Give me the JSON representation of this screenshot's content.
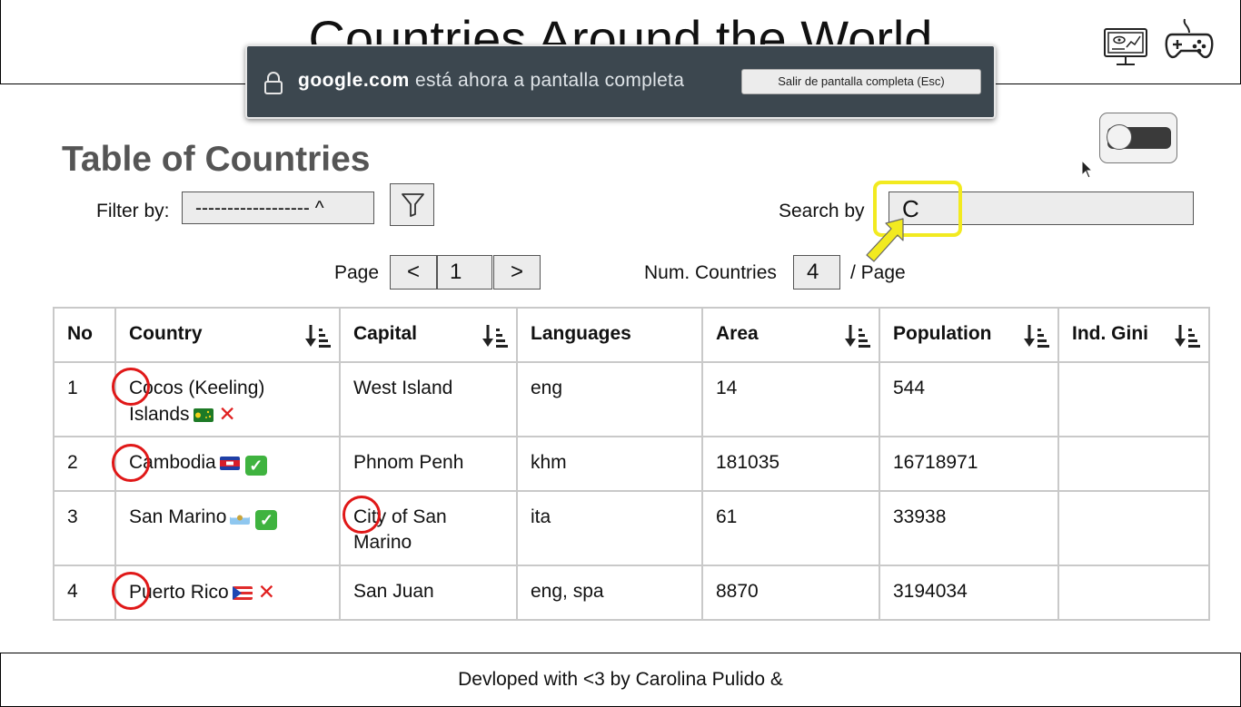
{
  "header": {
    "title": "Countries Around the World",
    "icons": [
      "dashboard-monitor-icon",
      "gamepad-icon"
    ]
  },
  "fullscreen_notice": {
    "domain": "google.com",
    "message": "está ahora a pantalla completa",
    "exit_button": "Salir de pantalla completa (Esc)"
  },
  "toggle": {
    "state": "off"
  },
  "section_title": "Table of Countries",
  "filter": {
    "label": "Filter by:",
    "selected": "------------------ ^",
    "button_icon": "funnel-icon"
  },
  "search": {
    "label": "Search by",
    "value": "C"
  },
  "pagination": {
    "label": "Page",
    "prev": "<",
    "current": "1",
    "next": ">"
  },
  "per_page": {
    "label": "Num. Countries",
    "value": "4",
    "suffix": "/ Page"
  },
  "table": {
    "headers": [
      "No",
      "Country",
      "Capital",
      "Languages",
      "Area",
      "Population",
      "Ind. Gini"
    ],
    "rows": [
      {
        "no": "1",
        "country": "Cocos (Keeling) Islands",
        "flag": "flag-cocos-islands",
        "status": "cross",
        "capital": "West Island",
        "languages": "eng",
        "area": "14",
        "population": "544",
        "gini": ""
      },
      {
        "no": "2",
        "country": "Cambodia",
        "flag": "flag-cambodia",
        "status": "check",
        "capital": "Phnom Penh",
        "languages": "khm",
        "area": "181035",
        "population": "16718971",
        "gini": ""
      },
      {
        "no": "3",
        "country": "San Marino",
        "flag": "flag-san-marino",
        "status": "check",
        "capital": "City of San Marino",
        "languages": "ita",
        "area": "61",
        "population": "33938",
        "gini": ""
      },
      {
        "no": "4",
        "country": "Puerto Rico",
        "flag": "flag-puerto-rico",
        "status": "cross",
        "capital": "San Juan",
        "languages": "eng, spa",
        "area": "8870",
        "population": "3194034",
        "gini": ""
      }
    ],
    "status_glyphs": {
      "check": "✓",
      "cross": "✕"
    }
  },
  "footer": {
    "text": "Devloped with <3 by Carolina Pulido &"
  },
  "colors": {
    "highlight": "#f2ea20",
    "ring": "#e01818",
    "notice_bg": "#3c474f"
  }
}
